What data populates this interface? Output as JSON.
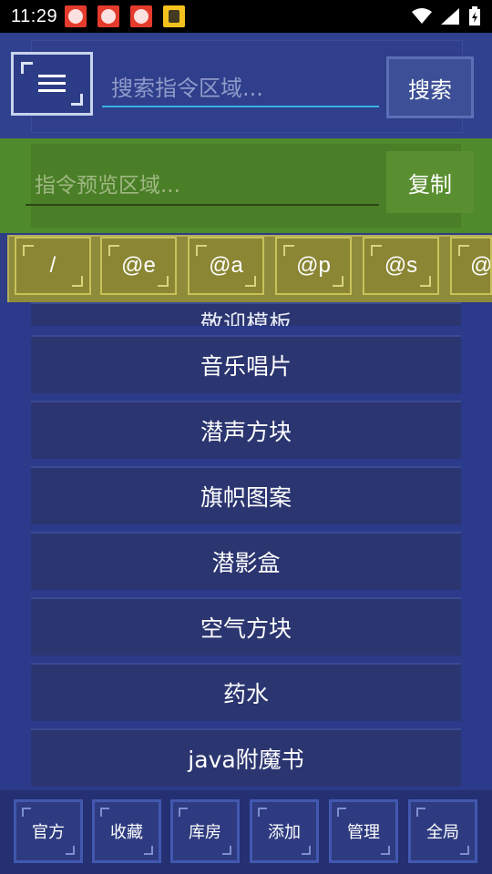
{
  "status": {
    "time": "11:29",
    "notification_icons": [
      "app-notification-icon",
      "app-notification-icon",
      "app-notification-icon",
      "app-notification-icon-yellow"
    ],
    "system_icons": [
      "wifi-icon",
      "signal-icon",
      "battery-icon"
    ]
  },
  "header": {
    "menu_icon": "hamburger-menu-icon",
    "search_placeholder": "搜索指令区域...",
    "search_label": "搜索"
  },
  "preview": {
    "placeholder": "指令预览区域...",
    "copy_label": "复制"
  },
  "quick_buttons": [
    "/",
    "@e",
    "@a",
    "@p",
    "@s",
    "@"
  ],
  "list": {
    "partial_item": "敬迎模板",
    "items": [
      "音乐唱片",
      "潜声方块",
      "旗帜图案",
      "潜影盒",
      "空气方块",
      "药水",
      "java附魔书"
    ]
  },
  "bottom_nav": [
    "官方",
    "收藏",
    "库房",
    "添加",
    "管理",
    "全局"
  ],
  "colors": {
    "background": "#2b3a8a",
    "search_underline": "#3ab0e6",
    "preview_bar": "#4f8a2b",
    "quick_strip": "#8e8c3a",
    "list_item": "#2b3570"
  }
}
